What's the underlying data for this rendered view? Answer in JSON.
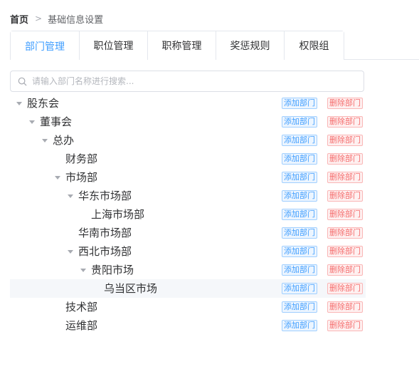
{
  "breadcrumb": {
    "home": "首页",
    "separator": ">",
    "current": "基础信息设置"
  },
  "tabs": [
    {
      "label": "部门管理",
      "active": true
    },
    {
      "label": "职位管理",
      "active": false
    },
    {
      "label": "职称管理",
      "active": false
    },
    {
      "label": "奖惩规则",
      "active": false
    },
    {
      "label": "权限组",
      "active": false
    }
  ],
  "search": {
    "icon": "search-icon",
    "placeholder": "请输入部门名称进行搜索...",
    "value": ""
  },
  "tree": {
    "add_label": "添加部门",
    "delete_label": "删除部门",
    "nodes": [
      {
        "label": "股东会",
        "level": 0,
        "expanded": true,
        "has_children": true
      },
      {
        "label": "董事会",
        "level": 1,
        "expanded": true,
        "has_children": true
      },
      {
        "label": "总办",
        "level": 2,
        "expanded": true,
        "has_children": true
      },
      {
        "label": "财务部",
        "level": 3,
        "has_children": false
      },
      {
        "label": "市场部",
        "level": 3,
        "expanded": true,
        "has_children": true
      },
      {
        "label": "华东市场部",
        "level": 4,
        "expanded": true,
        "has_children": true
      },
      {
        "label": "上海市场部",
        "level": 5,
        "has_children": false
      },
      {
        "label": "华南市场部",
        "level": 4,
        "has_children": false
      },
      {
        "label": "西北市场部",
        "level": 4,
        "expanded": true,
        "has_children": true
      },
      {
        "label": "贵阳市场",
        "level": 5,
        "expanded": true,
        "has_children": true
      },
      {
        "label": "乌当区市场",
        "level": 6,
        "has_children": false,
        "highlighted": true
      },
      {
        "label": "技术部",
        "level": 3,
        "has_children": false
      },
      {
        "label": "运维部",
        "level": 3,
        "has_children": false
      }
    ]
  },
  "colors": {
    "primary": "#409eff",
    "danger": "#f56c6c",
    "text": "#303133",
    "border": "#dcdfe6",
    "highlight_row": "#f5f7fa"
  }
}
